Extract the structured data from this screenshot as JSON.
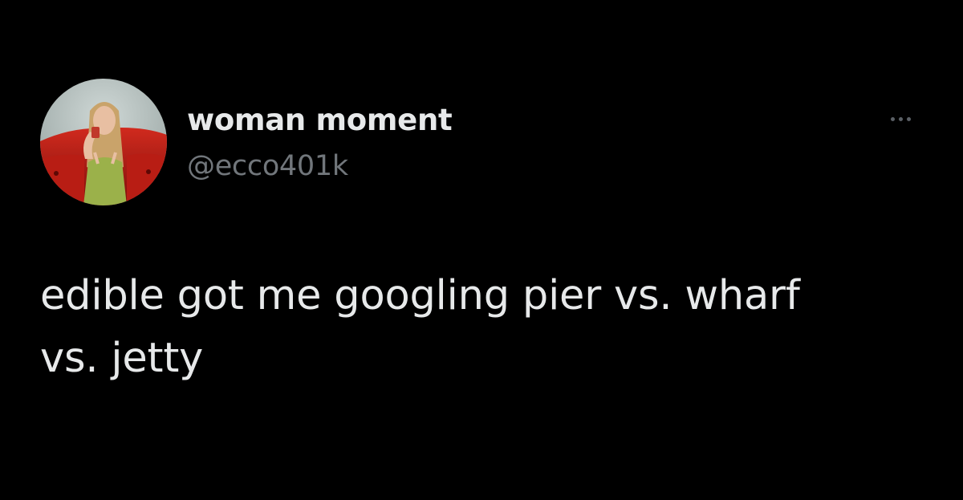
{
  "tweet": {
    "author": {
      "display_name": "woman moment",
      "handle": "@ecco401k",
      "avatar_icon": "profile-photo"
    },
    "more_icon": "ellipsis-icon",
    "text": "edible got me googling pier vs. wharf\nvs. jetty"
  },
  "colors": {
    "background": "#000000",
    "primary_text": "#e7e9ea",
    "secondary_text": "#71767b"
  }
}
